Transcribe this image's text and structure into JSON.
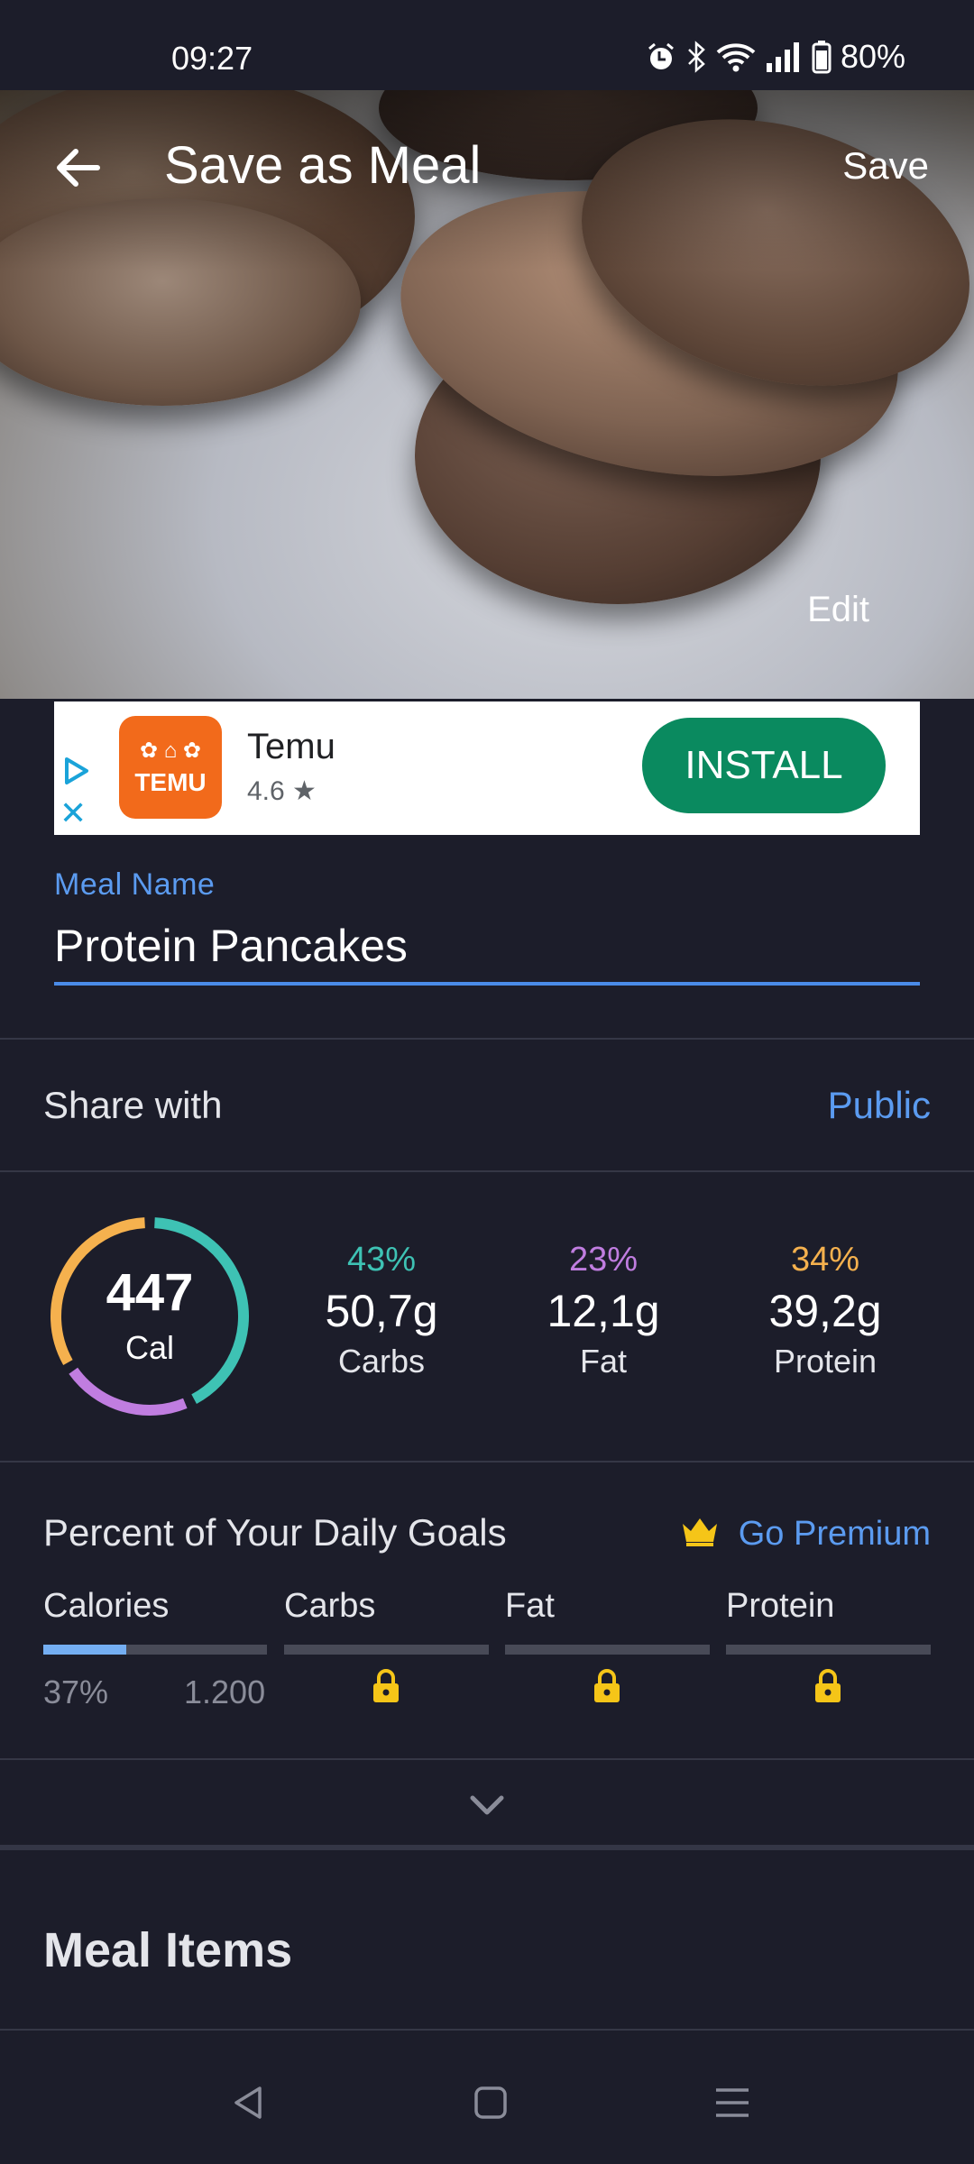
{
  "status_bar": {
    "time": "09:27",
    "battery": "80%"
  },
  "header": {
    "title": "Save as Meal",
    "save_label": "Save",
    "edit_label": "Edit"
  },
  "ad": {
    "app_name": "Temu",
    "rating": "4.6 ★",
    "logo_text": "TEMU",
    "install_label": "INSTALL"
  },
  "meal": {
    "label": "Meal Name",
    "value": "Protein Pancakes"
  },
  "share": {
    "label": "Share with",
    "value": "Public"
  },
  "summary": {
    "calories": "447",
    "cal_label": "Cal",
    "macros": [
      {
        "pct": "43%",
        "grams": "50,7g",
        "name": "Carbs",
        "color": "#3ec2b4"
      },
      {
        "pct": "23%",
        "grams": "12,1g",
        "name": "Fat",
        "color": "#c07de0"
      },
      {
        "pct": "34%",
        "grams": "39,2g",
        "name": "Protein",
        "color": "#f5b14e"
      }
    ]
  },
  "goals": {
    "title": "Percent of Your Daily Goals",
    "premium_label": "Go Premium",
    "columns": [
      "Calories",
      "Carbs",
      "Fat",
      "Protein"
    ],
    "calories_pct": "37%",
    "calories_goal": "1.200",
    "calories_fill": 0.37
  },
  "meal_items": {
    "title": "Meal Items"
  },
  "colors": {
    "accent": "#5b9bf0",
    "background": "#1c1d2a",
    "install": "#0a8a5f",
    "premium_icon": "#f5c518"
  }
}
